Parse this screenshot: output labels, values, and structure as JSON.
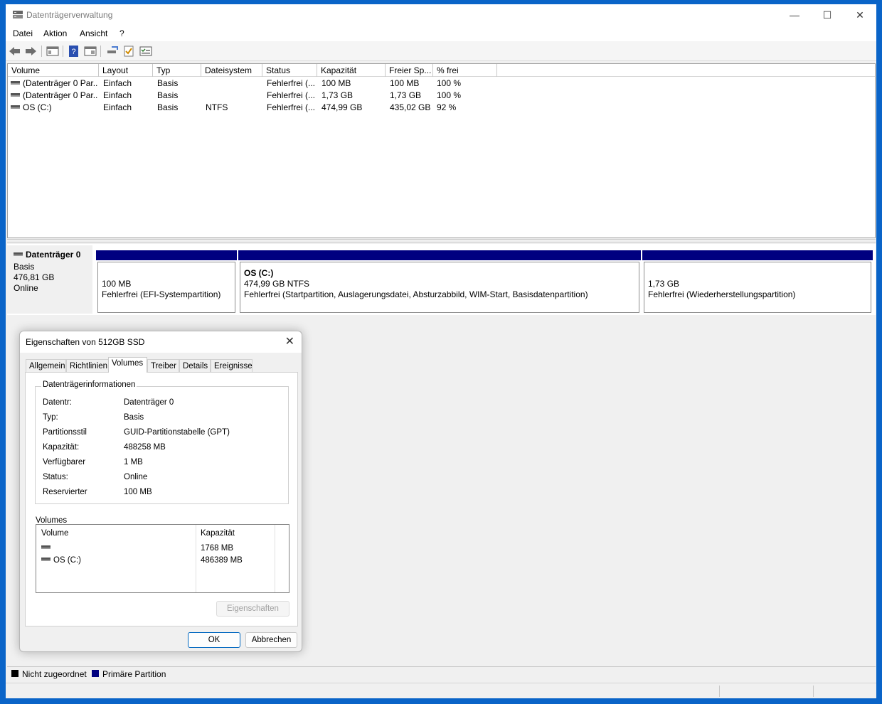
{
  "window": {
    "title": "Datenträgerverwaltung",
    "controls": {
      "minimize": "—",
      "maximize": "☐",
      "close": "✕"
    }
  },
  "menu": [
    "Datei",
    "Aktion",
    "Ansicht",
    "?"
  ],
  "volume_table": {
    "columns": [
      "Volume",
      "Layout",
      "Typ",
      "Dateisystem",
      "Status",
      "Kapazität",
      "Freier Sp...",
      "% frei"
    ],
    "rows": [
      {
        "volume": "(Datenträger 0 Par...",
        "layout": "Einfach",
        "typ": "Basis",
        "fs": "",
        "status": "Fehlerfrei (...",
        "capacity": "100 MB",
        "free": "100 MB",
        "pct": "100 %"
      },
      {
        "volume": "(Datenträger 0 Par...",
        "layout": "Einfach",
        "typ": "Basis",
        "fs": "",
        "status": "Fehlerfrei (...",
        "capacity": "1,73 GB",
        "free": "1,73 GB",
        "pct": "100 %"
      },
      {
        "volume": "OS (C:)",
        "layout": "Einfach",
        "typ": "Basis",
        "fs": "NTFS",
        "status": "Fehlerfrei (...",
        "capacity": "474,99 GB",
        "free": "435,02 GB",
        "pct": "92 %"
      }
    ]
  },
  "disk": {
    "name": "Datenträger 0",
    "type": "Basis",
    "size": "476,81 GB",
    "state": "Online",
    "partitions": [
      {
        "title": "",
        "line1": "100 MB",
        "line2": "Fehlerfrei (EFI-Systempartition)"
      },
      {
        "title": "OS  (C:)",
        "line1": "474,99 GB NTFS",
        "line2": "Fehlerfrei (Startpartition, Auslagerungsdatei, Absturzabbild, WIM-Start, Basisdatenpartition)"
      },
      {
        "title": "",
        "line1": "1,73 GB",
        "line2": "Fehlerfrei (Wiederherstellungspartition)"
      }
    ]
  },
  "legend": [
    {
      "label": "Nicht zugeordnet",
      "color": "#000000"
    },
    {
      "label": "Primäre Partition",
      "color": "#000080"
    }
  ],
  "dialog": {
    "title": "Eigenschaften von 512GB SSD",
    "close": "✕",
    "tabs": [
      "Allgemein",
      "Richtlinien",
      "Volumes",
      "Treiber",
      "Details",
      "Ereignisse"
    ],
    "active_tab": "Volumes",
    "group_title": "Datenträgerinformationen",
    "info": [
      {
        "label": "Datentr:",
        "value": "Datenträger 0"
      },
      {
        "label": "Typ:",
        "value": "Basis"
      },
      {
        "label": "Partitionsstil",
        "value": "GUID-Partitionstabelle (GPT)"
      },
      {
        "label": "Kapazität:",
        "value": "488258 MB"
      },
      {
        "label": "Verfügbarer",
        "value": "1 MB"
      },
      {
        "label": "Status:",
        "value": "Online"
      },
      {
        "label": "Reservierter",
        "value": "100 MB"
      }
    ],
    "volumes_label": "Volumes",
    "volumes_columns": [
      "Volume",
      "Kapazität"
    ],
    "volumes_rows": [
      {
        "volume": "",
        "capacity": "1768 MB"
      },
      {
        "volume": "OS (C:)",
        "capacity": "486389 MB"
      }
    ],
    "properties_button": "Eigenschaften",
    "ok_button": "OK",
    "cancel_button": "Abbrechen"
  }
}
